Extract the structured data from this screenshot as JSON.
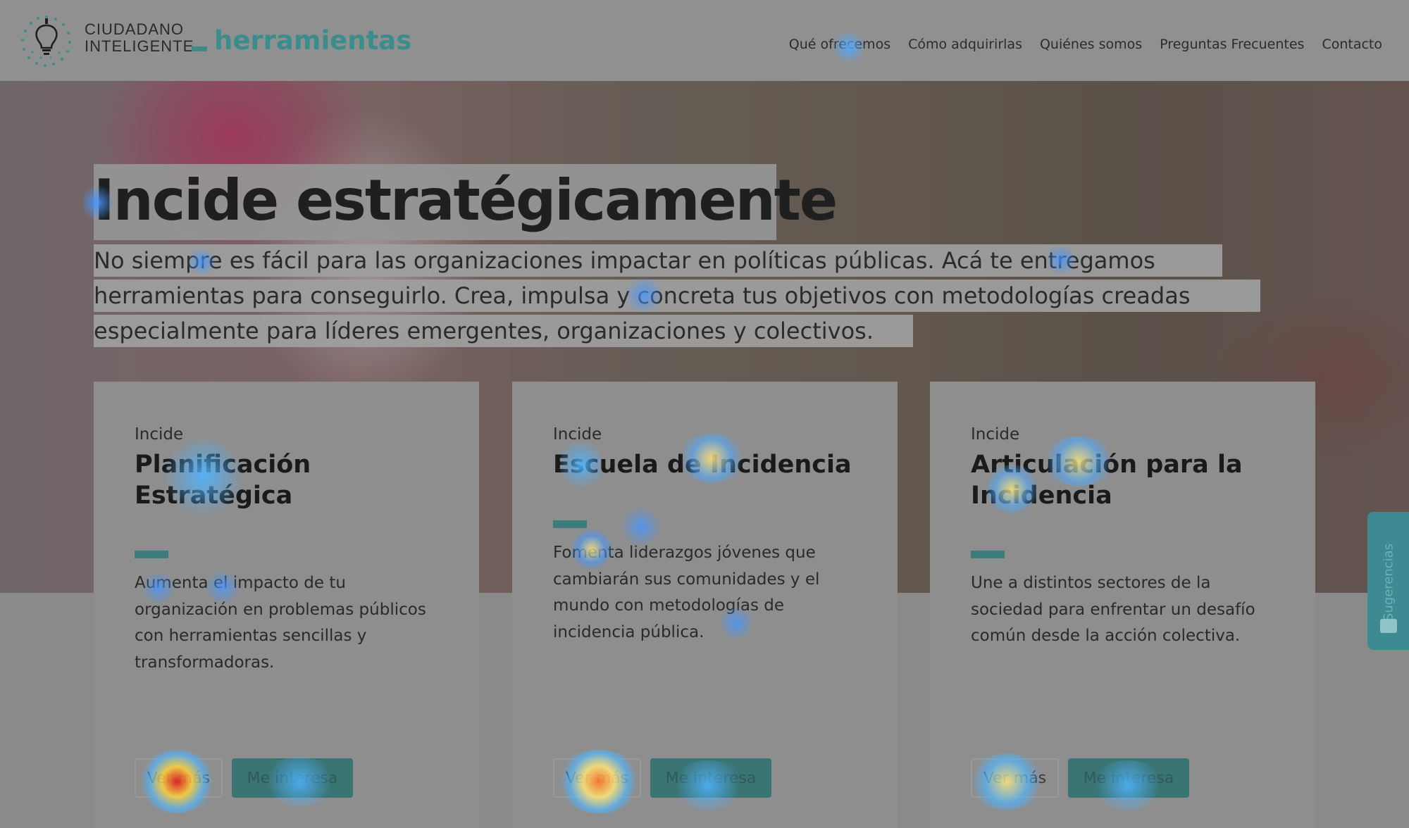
{
  "header": {
    "logo_line1": "CIUDADANO",
    "logo_line2": "INTELIGENTE",
    "logo_sub": "herramientas",
    "nav": [
      {
        "label": "Qué ofrecemos"
      },
      {
        "label": "Cómo adquirirlas"
      },
      {
        "label": "Quiénes somos"
      },
      {
        "label": "Preguntas Frecuentes"
      },
      {
        "label": "Contacto"
      }
    ]
  },
  "hero": {
    "title": "Incide estratégicamente",
    "description_lines": [
      "No siempre es fácil para las organizaciones impactar en políticas públicas. Acá te entregamos",
      "herramientas para conseguirlo. Crea, impulsa y concreta tus objetivos con metodologías creadas",
      "especialmente para líderes emergentes, organizaciones y colectivos."
    ]
  },
  "cards": [
    {
      "kicker": "Incide",
      "title": "Planificación Estratégica",
      "text": "Aumenta el impacto de tu organización en problemas públicos con herramientas sencillas y transformadoras.",
      "btn_more": "Ver más",
      "btn_interest": "Me interesa"
    },
    {
      "kicker": "Incide",
      "title": "Escuela de Incidencia",
      "text": "Fomenta liderazgos jóvenes que cambiarán sus comunidades y el mundo con metodologías de incidencia pública.",
      "btn_more": "Ver más",
      "btn_interest": "Me interesa"
    },
    {
      "kicker": "Incide",
      "title": "Articulación para la Incidencia",
      "text": "Une a distintos sectores de la sociedad para enfrentar un desafío común desde la acción colectiva.",
      "btn_more": "Ver más",
      "btn_interest": "Me interesa"
    }
  ],
  "feedback": {
    "label": "Sugerencias",
    "icon": "feedback-icon"
  },
  "colors": {
    "accent": "#3a8d8c",
    "feedback": "#3d8a93"
  }
}
